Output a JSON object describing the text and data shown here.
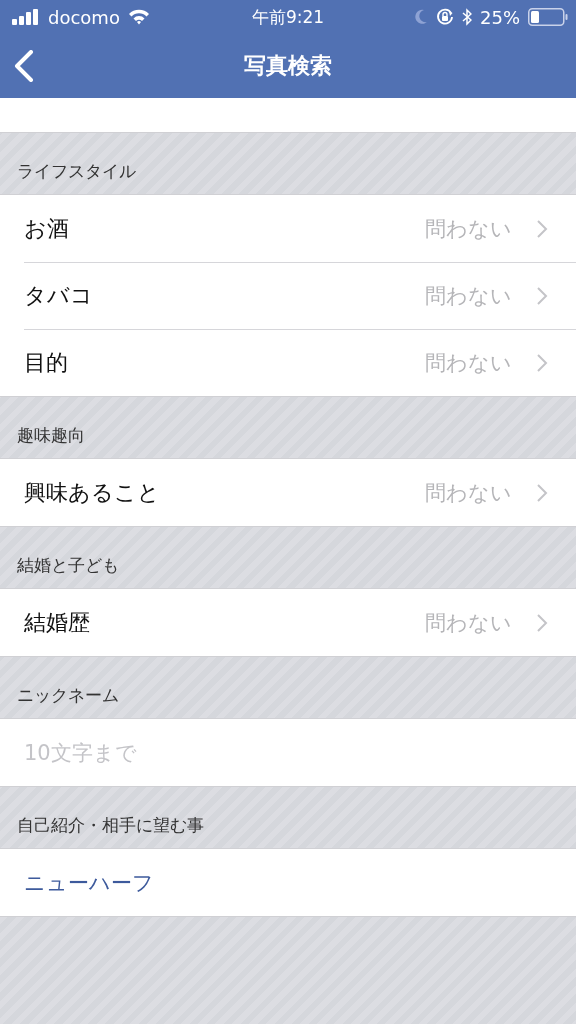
{
  "status_bar": {
    "carrier": "docomo",
    "time": "午前9:21",
    "battery": "25%"
  },
  "nav": {
    "title": "写真検索"
  },
  "sections": [
    {
      "header": "ライフスタイル",
      "rows": [
        {
          "kind": "select",
          "label": "お酒",
          "value": "問わない"
        },
        {
          "kind": "select",
          "label": "タバコ",
          "value": "問わない"
        },
        {
          "kind": "select",
          "label": "目的",
          "value": "問わない"
        }
      ]
    },
    {
      "header": "趣味趣向",
      "rows": [
        {
          "kind": "select",
          "label": "興味あること",
          "value": "問わない"
        }
      ]
    },
    {
      "header": "結婚と子ども",
      "rows": [
        {
          "kind": "select",
          "label": "結婚歴",
          "value": "問わない"
        }
      ]
    },
    {
      "header": "ニックネーム",
      "rows": [
        {
          "kind": "input",
          "placeholder": "10文字まで"
        }
      ]
    },
    {
      "header": "自己紹介・相手に望む事",
      "rows": [
        {
          "kind": "text",
          "value": "ニューハーフ"
        }
      ]
    }
  ]
}
